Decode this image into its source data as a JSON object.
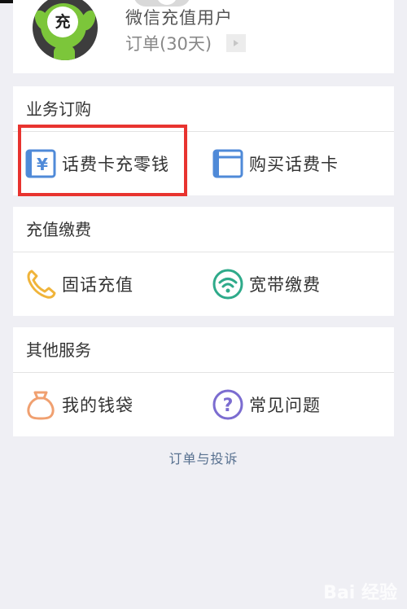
{
  "profile": {
    "avatar_char": "充",
    "user_name": "微信充值用户",
    "orders_text": "订单(30天)"
  },
  "sections": {
    "business": {
      "title": "业务订购",
      "items": [
        {
          "label": "话费卡充零钱",
          "icon": "yen-card-icon"
        },
        {
          "label": "购买话费卡",
          "icon": "card-icon"
        }
      ]
    },
    "recharge": {
      "title": "充值缴费",
      "items": [
        {
          "label": "固话充值",
          "icon": "phone-icon"
        },
        {
          "label": "宽带缴费",
          "icon": "wifi-icon"
        }
      ]
    },
    "other": {
      "title": "其他服务",
      "items": [
        {
          "label": "我的钱袋",
          "icon": "money-bag-icon"
        },
        {
          "label": "常见问题",
          "icon": "question-icon"
        }
      ]
    }
  },
  "footer": {
    "link": "订单与投诉"
  },
  "watermark": "Bai 经验",
  "colors": {
    "background": "#efeff4",
    "highlight": "#e8332f",
    "icon_blue": "#4f8ad8",
    "icon_orange": "#f0b43a",
    "icon_green": "#2eaa8a",
    "icon_bag": "#f0a070",
    "icon_purple": "#7b6cd0",
    "link": "#57708f"
  }
}
